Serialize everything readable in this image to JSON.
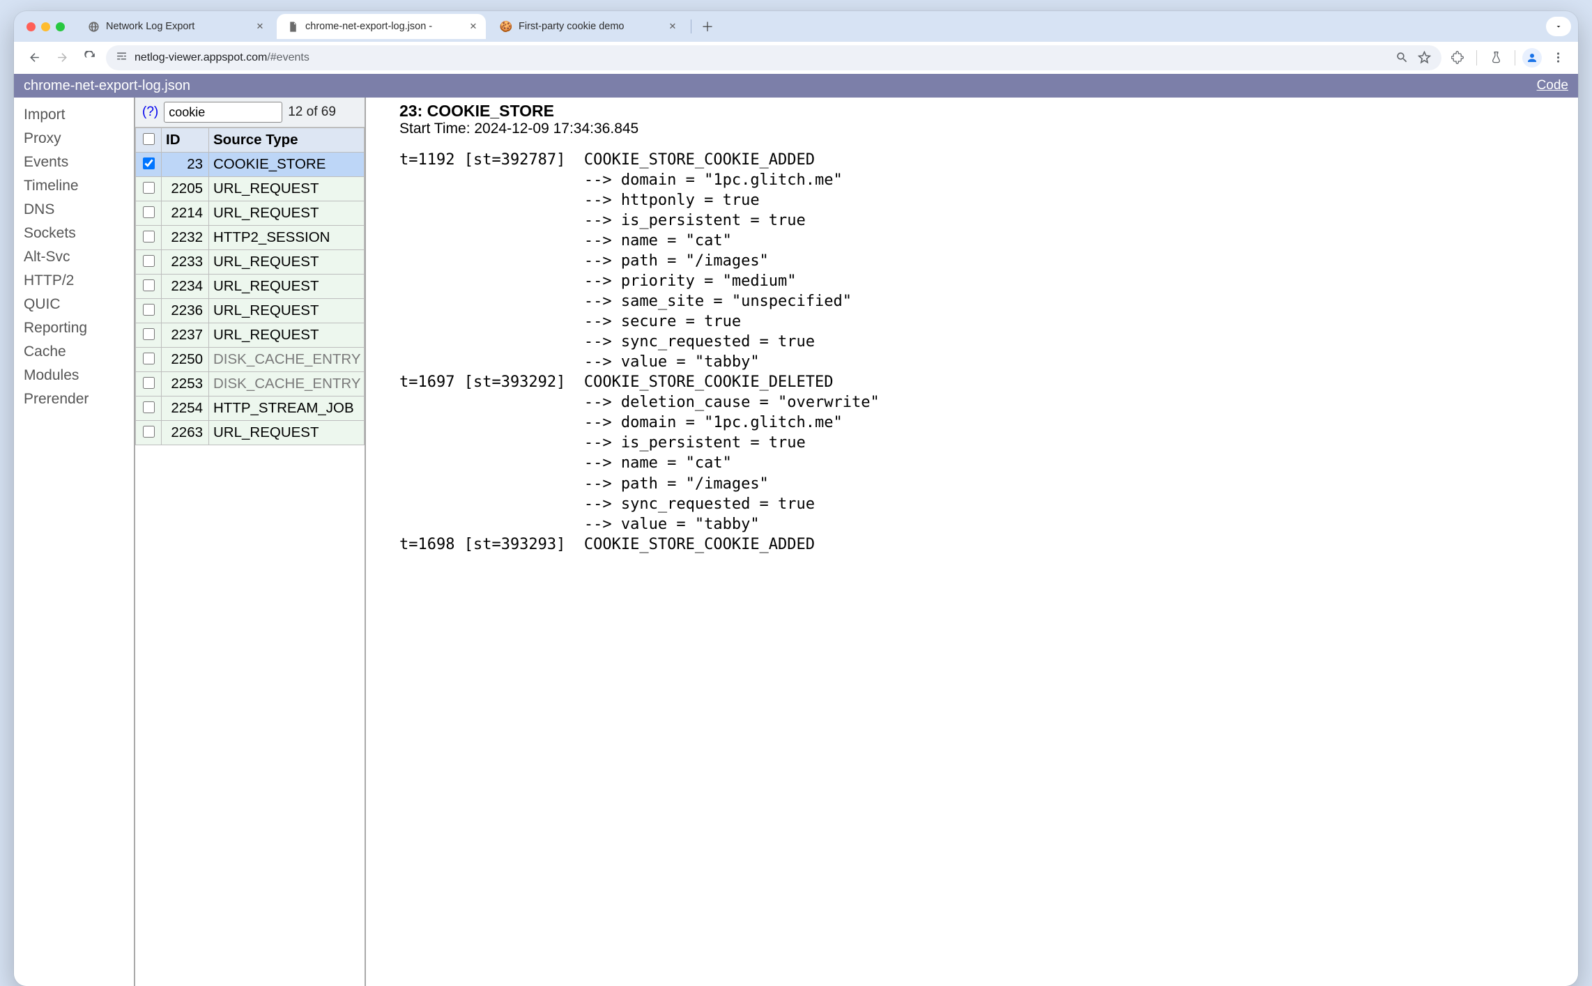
{
  "browser": {
    "tabs": [
      {
        "label": "Network Log Export",
        "icon": "globe"
      },
      {
        "label": "chrome-net-export-log.json - ",
        "icon": "doc",
        "active": true
      },
      {
        "label": "First-party cookie demo",
        "icon": "cookie"
      }
    ],
    "url_host": "netlog-viewer.appspot.com",
    "url_path": "/#events"
  },
  "header": {
    "title": "chrome-net-export-log.json",
    "right": "Code"
  },
  "sidebar": {
    "items": [
      "Import",
      "Proxy",
      "Events",
      "Timeline",
      "DNS",
      "Sockets",
      "Alt-Svc",
      "HTTP/2",
      "QUIC",
      "Reporting",
      "Cache",
      "Modules",
      "Prerender"
    ]
  },
  "filter": {
    "help": "(?)",
    "value": "cookie",
    "count": "12 of 69"
  },
  "columns": {
    "id": "ID",
    "type": "Source Type"
  },
  "rows": [
    {
      "id": "23",
      "type": "COOKIE_STORE",
      "checked": true,
      "selected": true
    },
    {
      "id": "2205",
      "type": "URL_REQUEST",
      "checked": false
    },
    {
      "id": "2214",
      "type": "URL_REQUEST",
      "checked": false
    },
    {
      "id": "2232",
      "type": "HTTP2_SESSION",
      "checked": false
    },
    {
      "id": "2233",
      "type": "URL_REQUEST",
      "checked": false
    },
    {
      "id": "2234",
      "type": "URL_REQUEST",
      "checked": false
    },
    {
      "id": "2236",
      "type": "URL_REQUEST",
      "checked": false
    },
    {
      "id": "2237",
      "type": "URL_REQUEST",
      "checked": false
    },
    {
      "id": "2250",
      "type": "DISK_CACHE_ENTRY",
      "checked": false,
      "dim": true
    },
    {
      "id": "2253",
      "type": "DISK_CACHE_ENTRY",
      "checked": false,
      "dim": true
    },
    {
      "id": "2254",
      "type": "HTTP_STREAM_JOB",
      "checked": false
    },
    {
      "id": "2263",
      "type": "URL_REQUEST",
      "checked": false
    }
  ],
  "detail": {
    "heading": "23: COOKIE_STORE",
    "start_time": "Start Time: 2024-12-09 17:34:36.845",
    "log": "t=1192 [st=392787]  COOKIE_STORE_COOKIE_ADDED\n                    --> domain = \"1pc.glitch.me\"\n                    --> httponly = true\n                    --> is_persistent = true\n                    --> name = \"cat\"\n                    --> path = \"/images\"\n                    --> priority = \"medium\"\n                    --> same_site = \"unspecified\"\n                    --> secure = true\n                    --> sync_requested = true\n                    --> value = \"tabby\"\nt=1697 [st=393292]  COOKIE_STORE_COOKIE_DELETED\n                    --> deletion_cause = \"overwrite\"\n                    --> domain = \"1pc.glitch.me\"\n                    --> is_persistent = true\n                    --> name = \"cat\"\n                    --> path = \"/images\"\n                    --> sync_requested = true\n                    --> value = \"tabby\"\nt=1698 [st=393293]  COOKIE_STORE_COOKIE_ADDED"
  }
}
